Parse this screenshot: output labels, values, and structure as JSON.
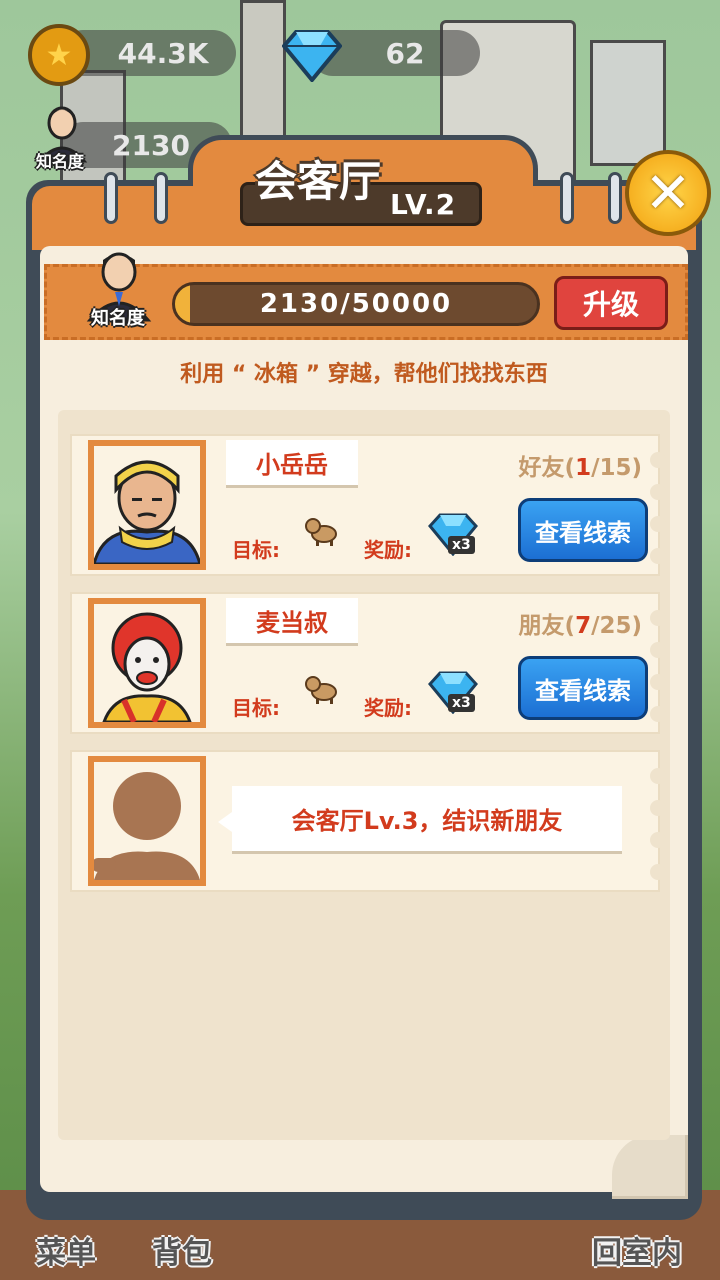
{
  "hud": {
    "coins": "44.3K",
    "gems": "62",
    "fame_label": "知名度",
    "fame_value": "2130"
  },
  "panel": {
    "title": "会客厅",
    "level": "LV.2",
    "fame_label": "知名度",
    "progress_text": "2130/50000",
    "progress_fraction": 0.0426,
    "upgrade_label": "升级",
    "hint": "利用 “ 冰箱 ” 穿越，帮他们找找东西"
  },
  "friends": [
    {
      "name": "小岳岳",
      "relation": "好友(",
      "current": "1",
      "total": "/15)",
      "goal_label": "目标:",
      "reward_label": "奖励:",
      "reward_mult": "x3",
      "clue_label": "查看线索"
    },
    {
      "name": "麦当叔",
      "relation": "朋友(",
      "current": "7",
      "total": "/25)",
      "goal_label": "目标:",
      "reward_label": "奖励:",
      "reward_mult": "x3",
      "clue_label": "查看线索"
    }
  ],
  "locked": {
    "message": "会客厅Lv.3，结识新朋友"
  },
  "bottom_nav": {
    "menu": "菜单",
    "bag": "背包",
    "back": "回室内"
  },
  "colors": {
    "panel_orange": "#e38a3f",
    "accent_red": "#d23b1d",
    "clue_blue": "#1c6fd3"
  }
}
